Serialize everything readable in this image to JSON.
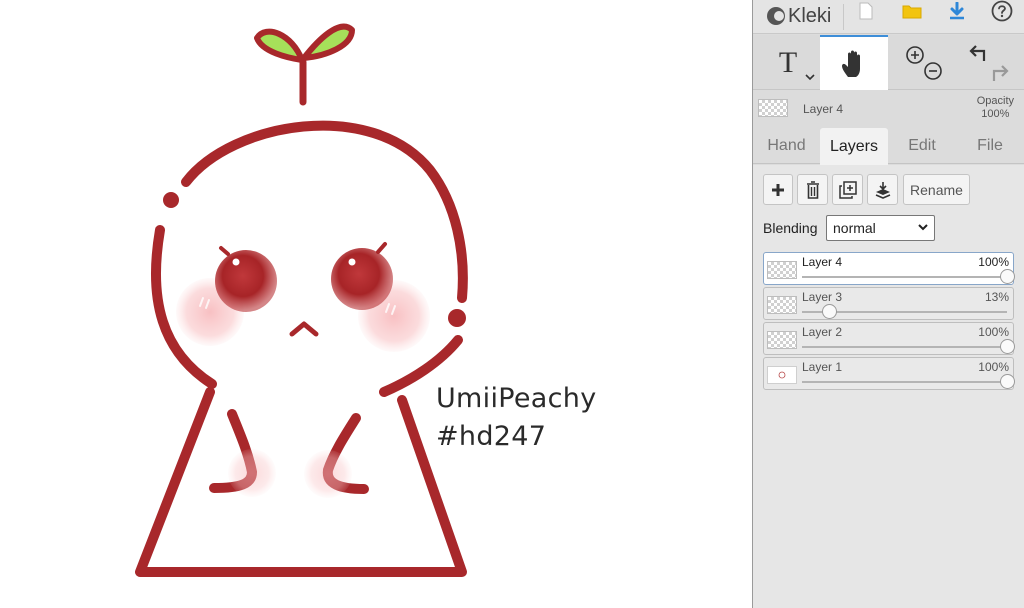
{
  "app": {
    "name": "Kleki",
    "logo_icon": "kleki-logo-icon"
  },
  "topbar": {
    "icons": [
      "new-file-icon",
      "open-folder-icon",
      "download-icon",
      "help-icon"
    ],
    "accent_color": "#2e87d8",
    "folder_color": "#f2c40f"
  },
  "tools": {
    "text_tool_label": "T",
    "active_tool": "hand"
  },
  "current_layer": {
    "name": "Layer 4",
    "opacity_label": "Opacity",
    "opacity_value": "100%"
  },
  "tabs": [
    {
      "label": "Hand"
    },
    {
      "label": "Layers"
    },
    {
      "label": "Edit"
    },
    {
      "label": "File"
    }
  ],
  "active_tab": "Layers",
  "layer_actions": {
    "rename_label": "Rename"
  },
  "blending": {
    "label": "Blending",
    "value": "normal"
  },
  "layers": [
    {
      "name": "Layer 4",
      "opacity_label": "100%",
      "opacity": 1.0,
      "selected": true
    },
    {
      "name": "Layer 3",
      "opacity_label": "13%",
      "opacity": 0.13,
      "selected": false
    },
    {
      "name": "Layer 2",
      "opacity_label": "100%",
      "opacity": 1.0,
      "selected": false
    },
    {
      "name": "Layer 1",
      "opacity_label": "100%",
      "opacity": 1.0,
      "selected": false
    }
  ],
  "canvas": {
    "signature_line1": "UmiiPeachy",
    "signature_line2": "#hd247",
    "stroke_color": "#a8282b",
    "leaf_color": "#a6e05a"
  }
}
